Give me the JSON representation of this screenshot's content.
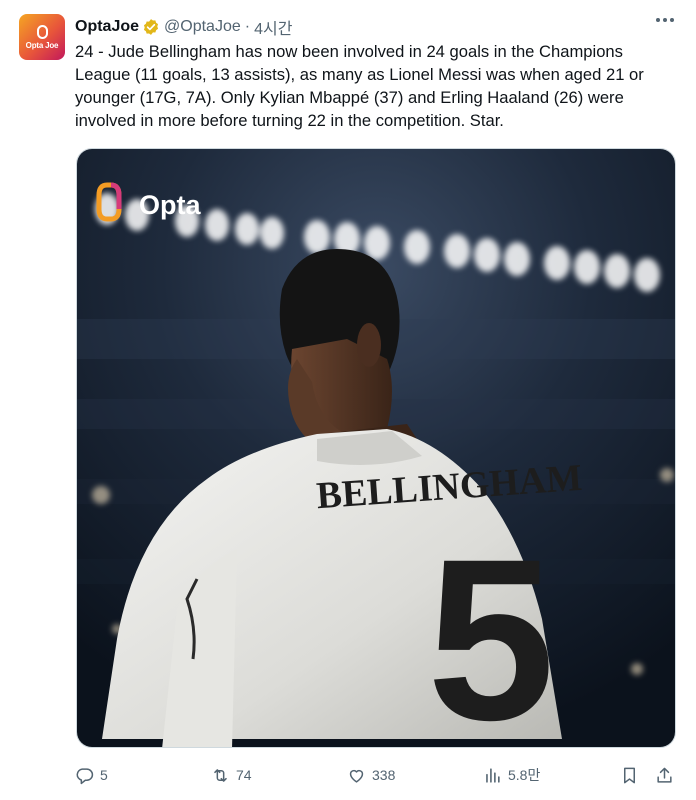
{
  "tweet": {
    "avatar_label": "Opta Joe",
    "display_name": "OptaJoe",
    "handle": "@OptaJoe",
    "separator": "·",
    "time": "4시간",
    "text": "24 - Jude Bellingham has now been involved in 24 goals in the Champions League (11 goals, 13 assists), as many as Lionel Messi was when aged 21 or younger (17G, 7A). Only Kylian Mbappé (37) and Erling Haaland (26) were involved in more before turning 22 in the competition. Star."
  },
  "media": {
    "watermark": "Opta",
    "shirt_name": "BELLINGHAM",
    "shirt_number": "5"
  },
  "actions": {
    "replies": "5",
    "retweets": "74",
    "likes": "338",
    "views": "5.8만"
  },
  "colors": {
    "verified": "#e2b719",
    "muted": "#536471"
  }
}
